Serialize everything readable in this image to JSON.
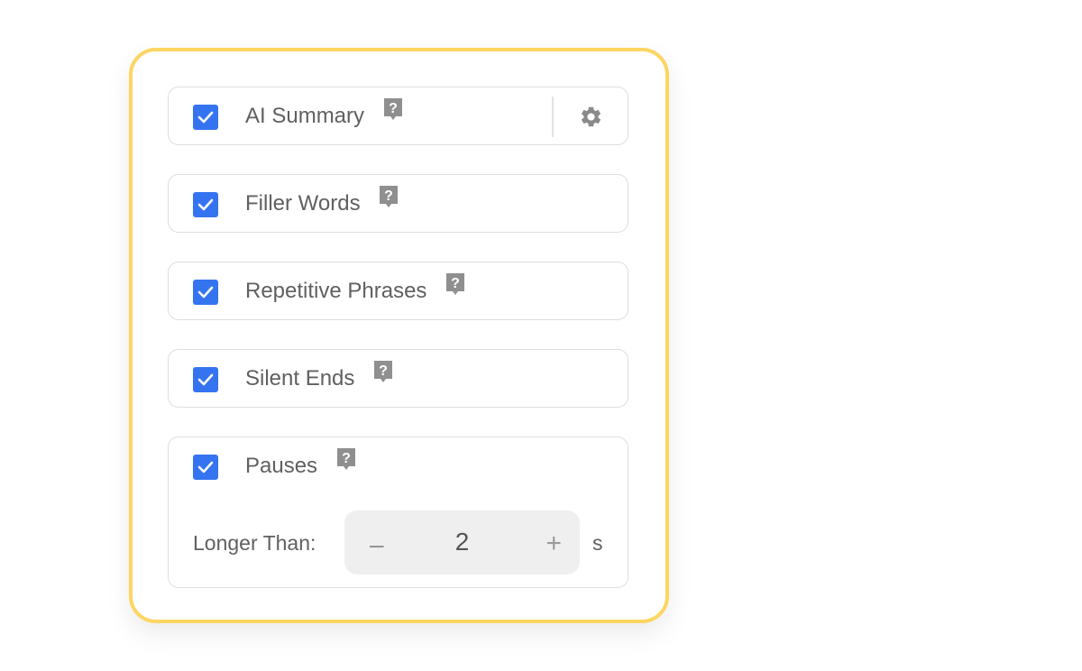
{
  "options": [
    {
      "label": "AI Summary",
      "checked": true,
      "has_settings": true
    },
    {
      "label": "Filler Words",
      "checked": true
    },
    {
      "label": "Repetitive Phrases",
      "checked": true
    },
    {
      "label": "Silent Ends",
      "checked": true
    },
    {
      "label": "Pauses",
      "checked": true
    }
  ],
  "pauses": {
    "threshold_label": "Longer Than:",
    "minus_symbol": "–",
    "value": "2",
    "plus_symbol": "+",
    "unit": "s"
  },
  "colors": {
    "accent": "#3574f0",
    "frame_border": "#fdd562"
  }
}
